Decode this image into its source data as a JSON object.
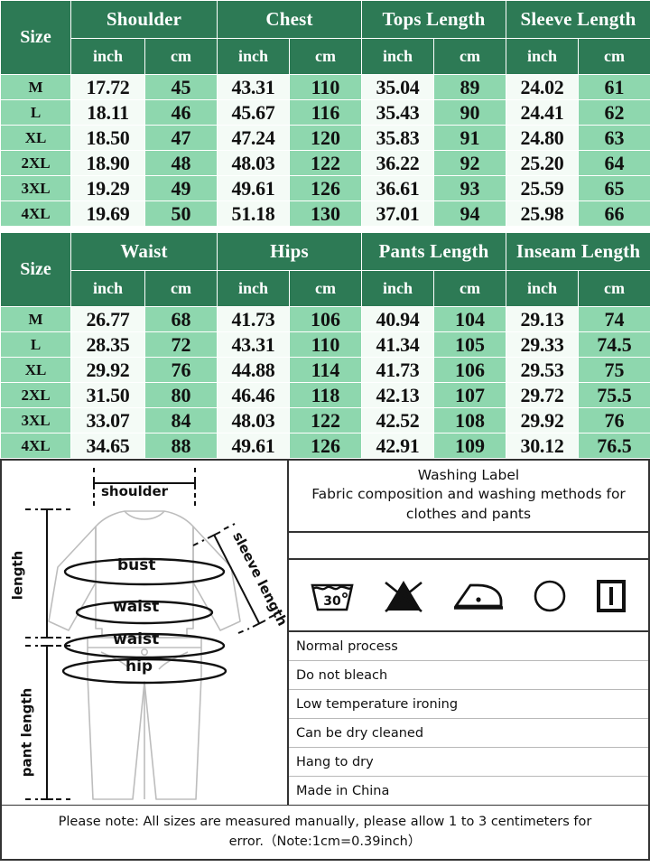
{
  "tops_table": {
    "size_header": "Size",
    "groups": [
      "Shoulder",
      "Chest",
      "Tops Length",
      "Sleeve Length"
    ],
    "units": [
      "inch",
      "cm",
      "inch",
      "cm",
      "inch",
      "cm",
      "inch",
      "cm"
    ],
    "rows": [
      {
        "size": "M",
        "cells": [
          "17.72",
          "45",
          "43.31",
          "110",
          "35.04",
          "89",
          "24.02",
          "61"
        ]
      },
      {
        "size": "L",
        "cells": [
          "18.11",
          "46",
          "45.67",
          "116",
          "35.43",
          "90",
          "24.41",
          "62"
        ]
      },
      {
        "size": "XL",
        "cells": [
          "18.50",
          "47",
          "47.24",
          "120",
          "35.83",
          "91",
          "24.80",
          "63"
        ]
      },
      {
        "size": "2XL",
        "cells": [
          "18.90",
          "48",
          "48.03",
          "122",
          "36.22",
          "92",
          "25.20",
          "64"
        ]
      },
      {
        "size": "3XL",
        "cells": [
          "19.29",
          "49",
          "49.61",
          "126",
          "36.61",
          "93",
          "25.59",
          "65"
        ]
      },
      {
        "size": "4XL",
        "cells": [
          "19.69",
          "50",
          "51.18",
          "130",
          "37.01",
          "94",
          "25.98",
          "66"
        ]
      }
    ]
  },
  "pants_table": {
    "size_header": "Size",
    "groups": [
      "Waist",
      "Hips",
      "Pants Length",
      "Inseam Length"
    ],
    "units": [
      "inch",
      "cm",
      "inch",
      "cm",
      "inch",
      "cm",
      "inch",
      "cm"
    ],
    "rows": [
      {
        "size": "M",
        "cells": [
          "26.77",
          "68",
          "41.73",
          "106",
          "40.94",
          "104",
          "29.13",
          "74"
        ]
      },
      {
        "size": "L",
        "cells": [
          "28.35",
          "72",
          "43.31",
          "110",
          "41.34",
          "105",
          "29.33",
          "74.5"
        ]
      },
      {
        "size": "XL",
        "cells": [
          "29.92",
          "76",
          "44.88",
          "114",
          "41.73",
          "106",
          "29.53",
          "75"
        ]
      },
      {
        "size": "2XL",
        "cells": [
          "31.50",
          "80",
          "46.46",
          "118",
          "42.13",
          "107",
          "29.72",
          "75.5"
        ]
      },
      {
        "size": "3XL",
        "cells": [
          "33.07",
          "84",
          "48.03",
          "122",
          "42.52",
          "108",
          "29.92",
          "76"
        ]
      },
      {
        "size": "4XL",
        "cells": [
          "34.65",
          "88",
          "49.61",
          "126",
          "42.91",
          "109",
          "30.12",
          "76.5"
        ]
      }
    ]
  },
  "diagram": {
    "labels": {
      "shoulder": "shoulder",
      "length": "length",
      "bust": "bust",
      "waist_top": "waist",
      "sleeve_length": "sleeve length",
      "waist_pants": "waist",
      "hip": "hip",
      "pant_length": "pant length"
    }
  },
  "washing": {
    "title_line1": "Washing Label",
    "title_line2": "Fabric composition and washing methods for clothes and pants",
    "symbols": [
      "wash-30-degrees-icon",
      "do-not-bleach-icon",
      "low-temperature-iron-icon",
      "dry-clean-icon",
      "hang-to-dry-icon"
    ],
    "wash_temp": "30",
    "instructions": [
      "Normal process",
      "Do not bleach",
      "Low temperature ironing",
      "Can be dry cleaned",
      "Hang to dry",
      "Made in China"
    ]
  },
  "footer": {
    "line1": "Please note: All sizes are measured manually, please allow 1 to 3 centimeters for",
    "line2": "error.（Note:1cm=0.39inch）"
  },
  "colors": {
    "header_green": "#2d7a55",
    "row_green": "#8ed7ae",
    "cell_white": "#f4fbf6",
    "border_dark": "#333333"
  }
}
